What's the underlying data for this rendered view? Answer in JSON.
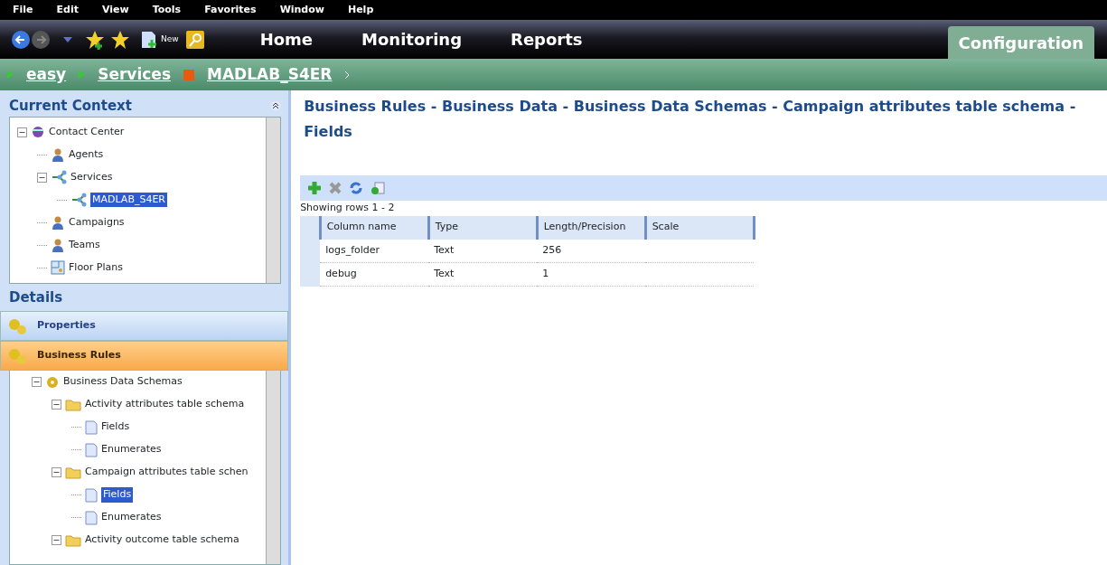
{
  "menu": [
    "File",
    "Edit",
    "View",
    "Tools",
    "Favorites",
    "Window",
    "Help"
  ],
  "toolbar": {
    "new_label": "New"
  },
  "tabs": [
    {
      "label": "Home",
      "selected": false
    },
    {
      "label": "Monitoring",
      "selected": false
    },
    {
      "label": "Reports",
      "selected": false
    },
    {
      "label": "Configuration",
      "selected": true
    }
  ],
  "breadcrumb": [
    {
      "label": "easy",
      "kind": "plain"
    },
    {
      "label": "Services",
      "kind": "plain"
    },
    {
      "label": "MADLAB_S4ER",
      "kind": "service"
    }
  ],
  "context": {
    "title": "Current Context",
    "tree": [
      {
        "label": "Contact Center",
        "kind": "center",
        "expanded": true,
        "selected": false,
        "children": [
          {
            "label": "Agents",
            "kind": "person",
            "selected": false
          },
          {
            "label": "Services",
            "kind": "service",
            "expanded": true,
            "selected": false,
            "children": [
              {
                "label": "MADLAB_S4ER",
                "kind": "service",
                "selected": true
              }
            ]
          },
          {
            "label": "Campaigns",
            "kind": "person",
            "selected": false
          },
          {
            "label": "Teams",
            "kind": "person",
            "selected": false
          },
          {
            "label": "Floor Plans",
            "kind": "plan",
            "selected": false
          }
        ]
      }
    ]
  },
  "details": {
    "title": "Details",
    "sections": [
      {
        "label": "Properties",
        "selected": false
      },
      {
        "label": "Business Rules",
        "selected": true
      }
    ],
    "tree": [
      {
        "label": "Business Data Schemas",
        "kind": "gear",
        "expanded": true,
        "selected": false,
        "children": [
          {
            "label": "Activity attributes table schema",
            "kind": "folder",
            "expanded": true,
            "selected": false,
            "children": [
              {
                "label": "Fields",
                "kind": "doc",
                "selected": false
              },
              {
                "label": "Enumerates",
                "kind": "doc",
                "selected": false
              }
            ]
          },
          {
            "label": "Campaign attributes table schen",
            "kind": "folder",
            "expanded": true,
            "selected": false,
            "children": [
              {
                "label": "Fields",
                "kind": "doc",
                "selected": true
              },
              {
                "label": "Enumerates",
                "kind": "doc",
                "selected": false
              }
            ]
          },
          {
            "label": "Activity outcome table schema",
            "kind": "folder",
            "expanded": true,
            "selected": false
          }
        ]
      }
    ]
  },
  "main": {
    "title": "Business Rules - Business Data - Business Data Schemas - Campaign attributes table schema - Fields",
    "rows_info": "Showing rows 1 - 2",
    "table": {
      "columns": [
        "Column name",
        "Type",
        "Length/Precision",
        "Scale"
      ],
      "rows": [
        [
          "logs_folder",
          "Text",
          "256",
          ""
        ],
        [
          "debug",
          "Text",
          "1",
          ""
        ]
      ]
    }
  }
}
